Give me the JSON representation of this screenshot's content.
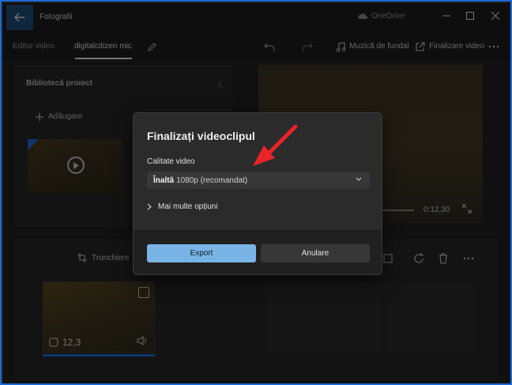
{
  "window": {
    "app_title": "Fotografii",
    "onedrive_label": "OneDrive"
  },
  "toolbar": {
    "editor_video_label": "Editor video",
    "project_name": "digitalcitizen mic",
    "music_label": "Muzică de fundal",
    "finalize_label": "Finalizare video"
  },
  "library": {
    "title": "Bibliotecă proiect",
    "add_label": "Adăugare"
  },
  "preview": {
    "time": "0:12,30"
  },
  "storyboard": {
    "trim_label": "Trunchiere",
    "clip_duration": "12,3"
  },
  "dialog": {
    "title": "Finalizați videoclipul",
    "quality_label": "Calitate video",
    "quality_bold": "Înaltă",
    "quality_rest": "1080p (recomandat)",
    "more_options_label": "Mai multe opțiuni",
    "export_label": "Export",
    "cancel_label": "Anulare"
  },
  "colors": {
    "accent": "#1e6ad6",
    "export_button": "#7ab4e6",
    "arrow": "#e8232a"
  }
}
